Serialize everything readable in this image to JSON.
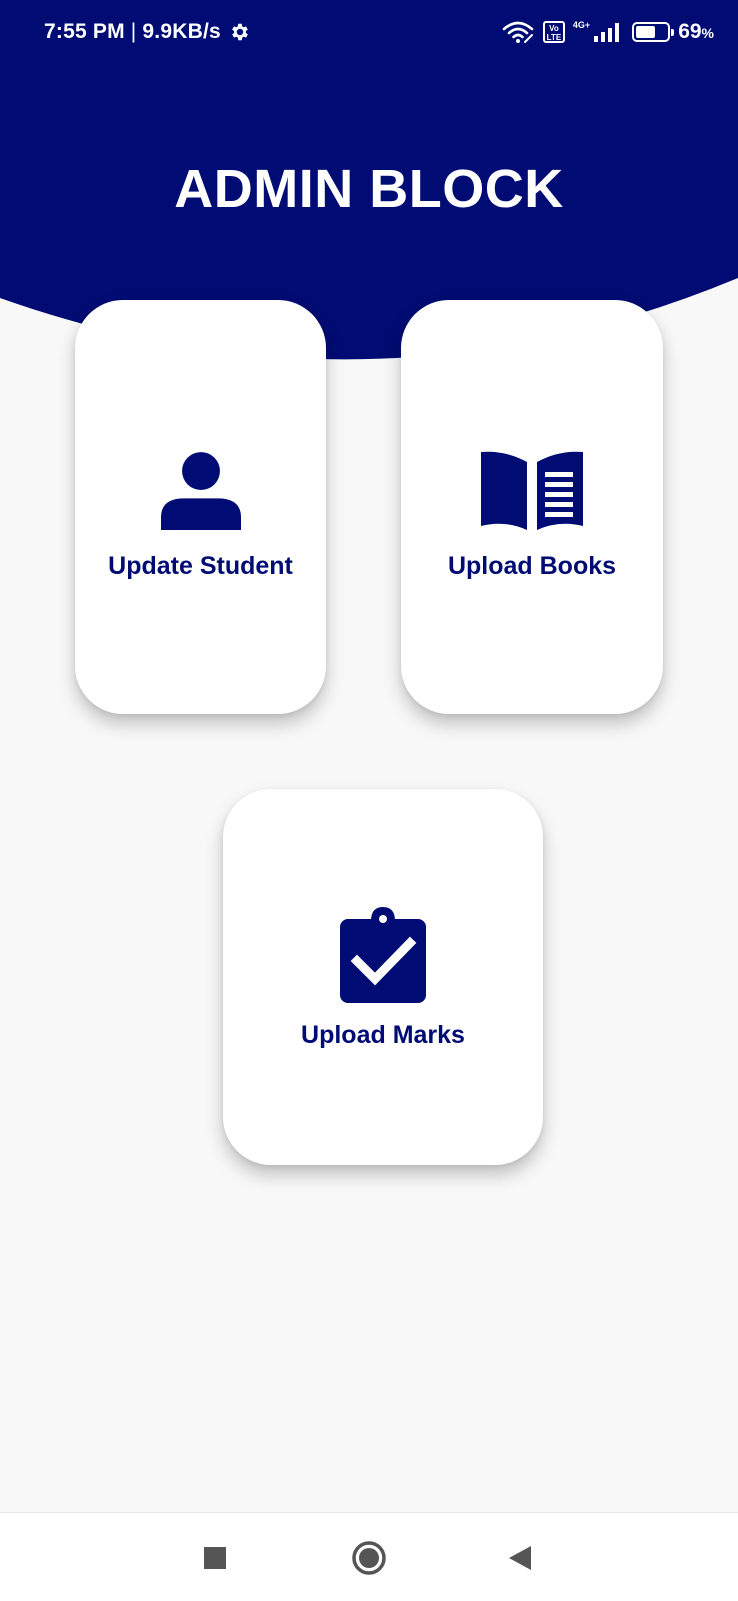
{
  "status_bar": {
    "time": "7:55 PM",
    "separator": "|",
    "net_speed": "9.9KB/s",
    "volte_label": "Vo LTE",
    "network_type": "4G+",
    "battery_percent": "69",
    "battery_unit": "%",
    "icons": [
      "settings-gear-icon",
      "wifi-icon",
      "volte-icon",
      "signal-icon",
      "battery-icon"
    ]
  },
  "header": {
    "title": "ADMIN BLOCK"
  },
  "cards": {
    "update_student": {
      "label": "Update Student",
      "icon": "person-icon"
    },
    "upload_books": {
      "label": "Upload Books",
      "icon": "book-icon"
    },
    "upload_marks": {
      "label": "Upload Marks",
      "icon": "clipboard-check-icon"
    }
  },
  "nav_bar": {
    "icons": [
      "recents-square-icon",
      "home-circle-icon",
      "back-triangle-icon"
    ]
  },
  "colors": {
    "primary": "#000c73",
    "background": "#f8f8f8",
    "card": "#ffffff",
    "nav_icon": "#555555"
  }
}
